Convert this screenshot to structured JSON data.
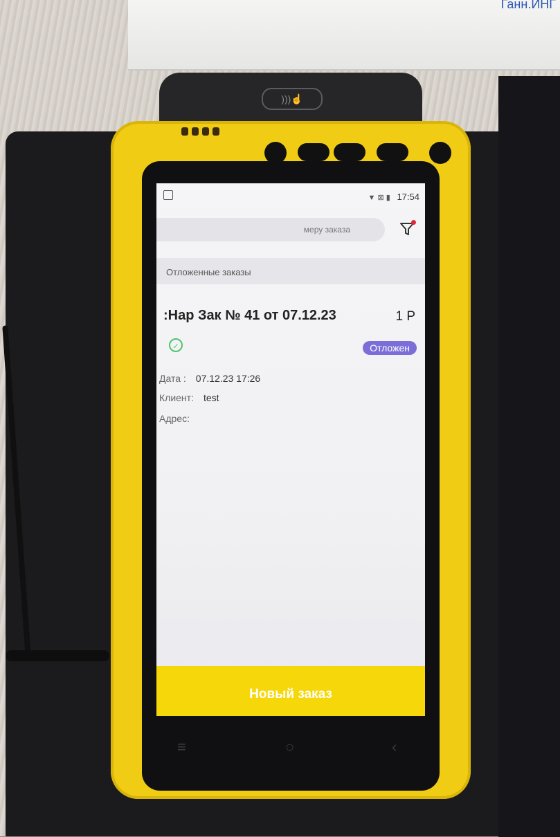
{
  "photo": {
    "corner_text": "Ганн.ИНГ"
  },
  "device": {
    "nfc_label": ")))☝"
  },
  "status_bar": {
    "time": "17:54",
    "signal": "▼ ⊠ ▮"
  },
  "search": {
    "placeholder": "меру заказа"
  },
  "section": {
    "title": "Отложенные заказы"
  },
  "order": {
    "title": ":Нар Зак № 41 от 07.12.23",
    "sum": "1 Р",
    "status_badge": "Отложен",
    "date_label": "Дата :",
    "date_value": "07.12.23 17:26",
    "client_label": "Клиент:",
    "client_value": "test",
    "address_label": "Адрес:",
    "address_value": ""
  },
  "actions": {
    "new_order": "Новый заказ"
  },
  "colors": {
    "accent_yellow": "#f6d70a",
    "badge_purple": "#7c6ed8",
    "sync_green": "#4cc36b",
    "filter_dot": "#e0283a"
  }
}
